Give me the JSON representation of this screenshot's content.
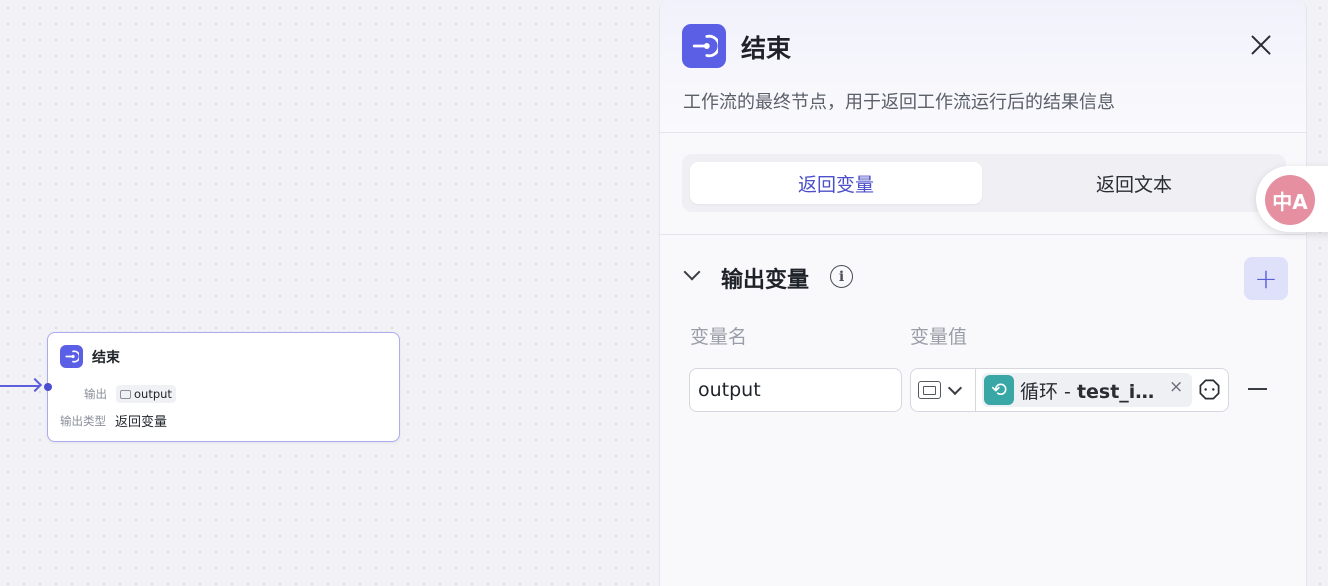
{
  "canvas": {
    "node": {
      "title": "结束",
      "output_label": "输出",
      "output_tag": "output",
      "output_type_label": "输出类型",
      "output_type_value": "返回变量"
    }
  },
  "panel": {
    "title": "结束",
    "description": "工作流的最终节点，用于返回工作流运行后的结果信息",
    "tabs": [
      {
        "label": "返回变量",
        "active": true
      },
      {
        "label": "返回文本",
        "active": false
      }
    ],
    "section": {
      "title": "输出变量",
      "info_glyph": "i",
      "add_glyph": "+",
      "col_name": "变量名",
      "col_value": "变量值",
      "row": {
        "name": "output",
        "ref_node": "循环 - ",
        "ref_var": "test_i…",
        "remove_glyph": "×"
      }
    }
  },
  "translate_button": {
    "label": "中A"
  },
  "colors": {
    "accent": "#5b5fe6",
    "loop_icon": "#3aa7a7",
    "translate": "#e58fa0"
  },
  "icons": [
    "end-node-icon",
    "close-icon",
    "info-icon",
    "plus-icon",
    "chevron-down-icon",
    "image-type-icon",
    "loop-icon",
    "variable-icon",
    "minus-icon",
    "translate-icon"
  ]
}
